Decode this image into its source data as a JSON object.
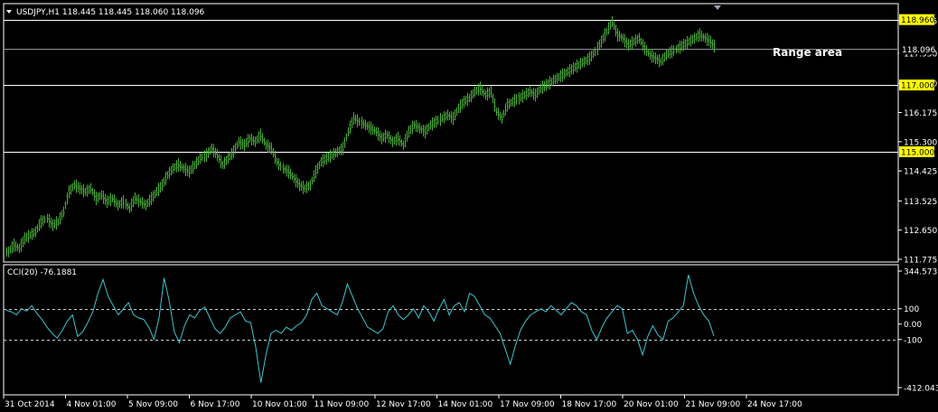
{
  "colors": {
    "background": "#000000",
    "grid_frame": "#ffffff",
    "candle": "#4caf3a",
    "cci_line": "#3ec6d0",
    "hline": "#ffffff",
    "hline_label_bg": "#ffff00",
    "axis_text": "#ffffff"
  },
  "header": {
    "title": "USDJPY,H1  118.445 118.445 118.060 118.096",
    "dropdown_icon": "triangle-down-icon"
  },
  "annotation": {
    "range_text": "Range area"
  },
  "price_axis": {
    "ticks": [
      "118.925",
      "117.950",
      "117.050",
      "116.175",
      "115.300",
      "114.425",
      "113.525",
      "112.650",
      "111.775"
    ],
    "current_price": "118.096",
    "levels": [
      "118.960",
      "117.000",
      "115.000"
    ]
  },
  "cci": {
    "title": "CCI(20) -76.1881",
    "ticks": [
      "344.5732",
      "100",
      "0.00",
      "-100",
      "-412.0435"
    ]
  },
  "time_axis": {
    "labels": [
      "31 Oct 2014",
      "4 Nov 01:00",
      "5 Nov 09:00",
      "6 Nov 17:00",
      "10 Nov 01:00",
      "11 Nov 09:00",
      "12 Nov 17:00",
      "14 Nov 01:00",
      "17 Nov 09:00",
      "18 Nov 17:00",
      "20 Nov 01:00",
      "21 Nov 09:00",
      "24 Nov 17:00"
    ]
  },
  "chart_data": {
    "type": "line",
    "symbol": "USDJPY",
    "timeframe": "H1",
    "ylim": [
      111.775,
      118.925
    ],
    "price_series": [
      {
        "name": "USDJPY",
        "values": [
          112.0,
          112.2,
          112.1,
          112.4,
          112.5,
          112.6,
          112.9,
          113.0,
          112.8,
          112.9,
          113.2,
          113.8,
          114.0,
          113.9,
          113.8,
          113.9,
          113.6,
          113.7,
          113.5,
          113.6,
          113.4,
          113.5,
          113.3,
          113.6,
          113.5,
          113.4,
          113.6,
          113.8,
          114.0,
          114.3,
          114.5,
          114.6,
          114.5,
          114.4,
          114.6,
          114.8,
          114.9,
          115.1,
          114.9,
          114.6,
          114.8,
          115.0,
          115.3,
          115.2,
          115.4,
          115.3,
          115.5,
          115.2,
          115.1,
          114.7,
          114.5,
          114.4,
          114.2,
          114.0,
          113.9,
          114.0,
          114.4,
          114.7,
          114.8,
          114.9,
          115.0,
          115.1,
          115.6,
          116.0,
          115.9,
          115.8,
          115.7,
          115.6,
          115.4,
          115.5,
          115.3,
          115.4,
          115.2,
          115.6,
          115.8,
          115.7,
          115.6,
          115.8,
          115.9,
          116.0,
          116.1,
          116.0,
          116.3,
          116.5,
          116.6,
          116.8,
          116.9,
          116.7,
          116.8,
          116.2,
          116.0,
          116.4,
          116.5,
          116.6,
          116.7,
          116.8,
          116.7,
          116.9,
          117.0,
          117.1,
          117.2,
          117.3,
          117.4,
          117.5,
          117.6,
          117.7,
          117.8,
          118.0,
          118.3,
          118.6,
          118.9,
          118.5,
          118.4,
          118.2,
          118.3,
          118.4,
          118.1,
          117.9,
          117.8,
          117.7,
          117.9,
          118.0,
          118.1,
          118.2,
          118.3,
          118.4,
          118.5,
          118.4,
          118.3,
          118.1
        ]
      }
    ],
    "horizontal_levels": [
      118.96,
      117.0,
      115.0
    ],
    "cci_ylim": [
      -412.0435,
      344.5732
    ],
    "cci_levels": [
      100,
      0,
      -100
    ],
    "cci_series": [
      {
        "name": "CCI(20)",
        "values": [
          90,
          80,
          60,
          100,
          85,
          120,
          70,
          30,
          -20,
          -60,
          -90,
          -40,
          20,
          60,
          -80,
          -50,
          10,
          80,
          200,
          290,
          180,
          120,
          60,
          100,
          140,
          60,
          40,
          30,
          -20,
          -100,
          40,
          300,
          150,
          -50,
          -120,
          -10,
          60,
          40,
          90,
          110,
          40,
          -30,
          -60,
          -20,
          40,
          60,
          80,
          20,
          10,
          -150,
          -380,
          -200,
          -60,
          -40,
          -60,
          -20,
          -40,
          -10,
          10,
          60,
          160,
          200,
          120,
          100,
          80,
          60,
          140,
          260,
          180,
          100,
          40,
          -20,
          -40,
          -60,
          -30,
          80,
          120,
          60,
          30,
          60,
          100,
          40,
          120,
          80,
          20,
          100,
          160,
          60,
          120,
          140,
          80,
          200,
          180,
          120,
          60,
          40,
          -10,
          -60,
          -160,
          -260,
          -140,
          -40,
          20,
          60,
          80,
          100,
          80,
          120,
          90,
          60,
          100,
          140,
          120,
          80,
          60,
          -40,
          -100,
          -20,
          40,
          80,
          120,
          100,
          -60,
          -40,
          -100,
          -200,
          -80,
          -10,
          -70,
          -100,
          20,
          40,
          80,
          120,
          320,
          200,
          120,
          60,
          20,
          -76
        ]
      }
    ]
  }
}
